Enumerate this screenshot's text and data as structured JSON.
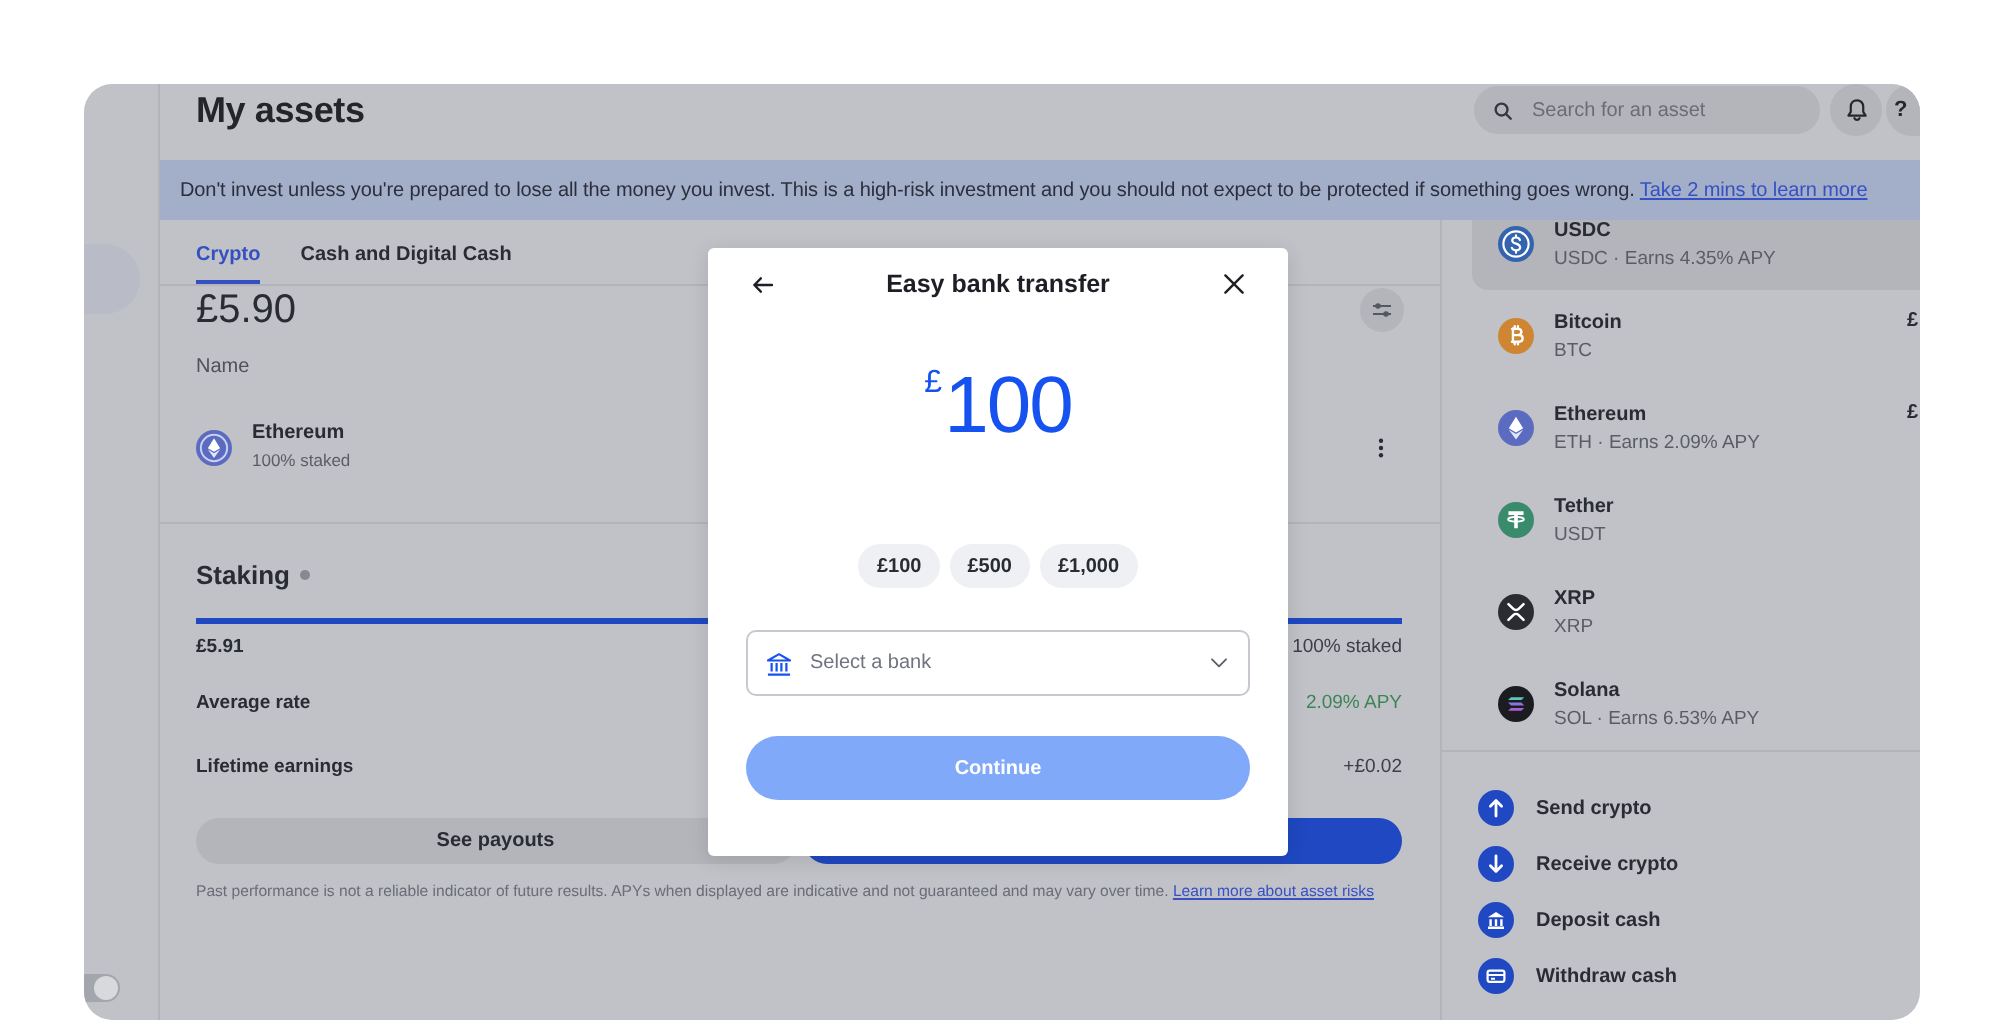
{
  "sidebar": {
    "toggle": {
      "on": true
    }
  },
  "header": {
    "title": "My assets",
    "search": {
      "placeholder": "Search for an asset"
    },
    "help": "?"
  },
  "banner": {
    "text": "Don't invest unless you're prepared to lose all the money you invest. This is a high-risk investment and you should not expect to be protected if something goes wrong.",
    "link": "Take 2 mins to learn more"
  },
  "tabs": [
    {
      "label": "Crypto",
      "selected": true
    },
    {
      "label": "Cash and Digital Cash",
      "selected": false
    }
  ],
  "balance": "£5.90",
  "holdings": {
    "column": "Name",
    "rows": [
      {
        "name": "Ethereum",
        "detail": "100% staked"
      }
    ]
  },
  "staking": {
    "title": "Staking",
    "level": 1,
    "amount": "£5.91",
    "share": "100% staked",
    "stats": [
      {
        "label": "Average rate",
        "value": "2.09% APY",
        "kind": "positive"
      },
      {
        "label": "Lifetime earnings",
        "value": "+£0.02",
        "kind": "plain"
      }
    ],
    "buttons": [
      {
        "kind": "secondary",
        "label": "See payouts"
      },
      {
        "kind": "primary"
      }
    ],
    "disclaimer": {
      "text": "Past performance is not a reliable indicator of future results. APYs when displayed are indicative and not guaranteed and may vary over time.",
      "link": "Learn more about asset risks"
    }
  },
  "assets": [
    {
      "name": "USDC",
      "detail": "USDC · Earns 4.35% APY",
      "kind": "dollar",
      "color": "#3464b0",
      "selected": true
    },
    {
      "name": "Bitcoin",
      "detail": "BTC",
      "value": "£",
      "kind": "bitcoin",
      "color": "#cf8632",
      "selected": false
    },
    {
      "name": "Ethereum",
      "detail": "ETH · Earns 2.09% APY",
      "value": "£",
      "kind": "ethereum",
      "color": "#5b6bc0",
      "selected": false
    },
    {
      "name": "Tether",
      "detail": "USDT",
      "kind": "tether",
      "color": "#3a8a6c",
      "selected": false
    },
    {
      "name": "XRP",
      "detail": "XRP",
      "kind": "xrp",
      "color": "#2b2c31",
      "selected": false
    },
    {
      "name": "Solana",
      "detail": "SOL · Earns 6.53% APY",
      "kind": "solana",
      "color": "#1b1c20",
      "selected": false
    }
  ],
  "actions": [
    {
      "label": "Send crypto",
      "kind": "send"
    },
    {
      "label": "Receive crypto",
      "kind": "receive"
    },
    {
      "label": "Deposit cash",
      "kind": "deposit"
    },
    {
      "label": "Withdraw cash",
      "kind": "withdraw"
    }
  ],
  "modal": {
    "title": "Easy bank transfer",
    "currency": "£",
    "amount": "100",
    "presets": [
      "£100",
      "£500",
      "£1,000"
    ],
    "bank_select": {
      "placeholder": "Select a bank"
    },
    "continue": {
      "label": "Continue",
      "disabled": true
    }
  }
}
